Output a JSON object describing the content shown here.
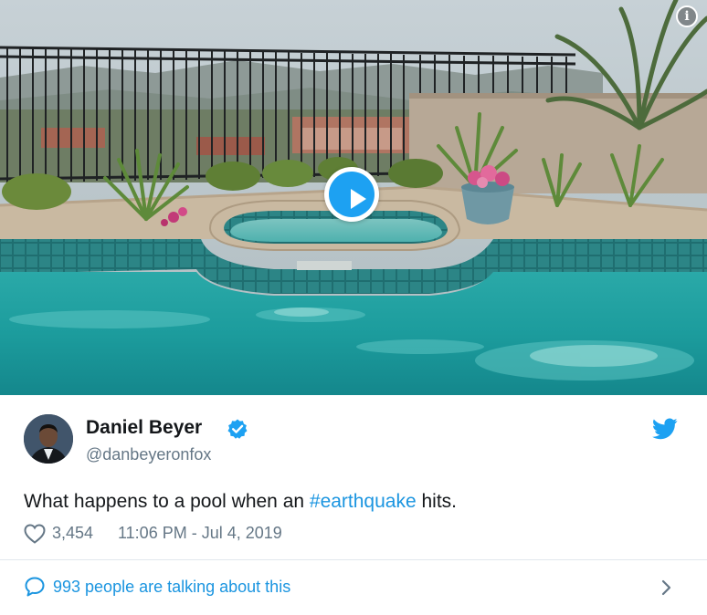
{
  "media": {
    "kind": "video",
    "play_icon": "play-icon",
    "info_icon": "info-icon",
    "info_glyph": "i"
  },
  "author": {
    "name": "Daniel Beyer",
    "handle": "@danbeyeronfox",
    "verified": true,
    "verified_icon": "verified-badge-icon"
  },
  "platform_icon": "twitter-bird-icon",
  "tweet": {
    "text_before": "What happens to a pool when an ",
    "hashtag": "#earthquake",
    "text_after": " hits."
  },
  "meta": {
    "like_icon": "heart-icon",
    "likes": "3,454",
    "timestamp": "11:06 PM - Jul 4, 2019"
  },
  "footer": {
    "icon": "speech-bubble-icon",
    "talking_text": "993 people are talking about this",
    "chevron_icon": "chevron-right-icon"
  },
  "colors": {
    "accent": "#1da1f2",
    "link": "#1b95e0",
    "secondary_text": "#657786",
    "divider": "#e1e8ed",
    "pool_water": "#1fa3a3"
  }
}
